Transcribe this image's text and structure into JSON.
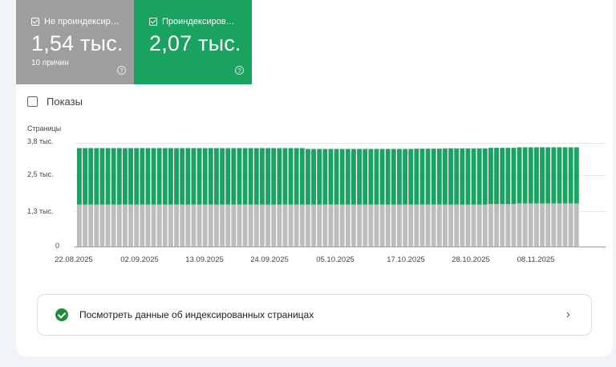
{
  "tiles": {
    "not_indexed": {
      "label": "Не проиндексир…",
      "value": "1,54 тыс.",
      "sub": "10 причин",
      "help": "?"
    },
    "indexed": {
      "label": "Проиндексиров…",
      "value": "2,07 тыс.",
      "help": "?"
    }
  },
  "impressions_label": "Показы",
  "link_label": "Посмотреть данные об индексированных страницах",
  "chart_data": {
    "type": "bar",
    "stacked": true,
    "ylabel": "Страницы",
    "ylim": [
      0,
      3800
    ],
    "yticks": [
      "3,8 тыс.",
      "2,5 тыс.",
      "1,3 тыс.",
      "0"
    ],
    "xticks": [
      "22.08.2025",
      "02.09.2025",
      "13.09.2025",
      "24.09.2025",
      "05.10.2025",
      "17.10.2025",
      "28.10.2025",
      "08.11.2025"
    ],
    "first_date": "22.08.2025",
    "last_date": "16.11.2025",
    "series": [
      {
        "name": "Не проиндексир…",
        "color": "#bdbdbd",
        "values": [
          1540,
          1540,
          1540,
          1540,
          1540,
          1540,
          1540,
          1540,
          1540,
          1540,
          1540,
          1540,
          1540,
          1540,
          1540,
          1540,
          1540,
          1540,
          1540,
          1540,
          1540,
          1540,
          1540,
          1540,
          1540,
          1540,
          1540,
          1540,
          1540,
          1540,
          1540,
          1540,
          1540,
          1540,
          1540,
          1540,
          1540,
          1540,
          1540,
          1540,
          1540,
          1540,
          1540,
          1540,
          1540,
          1540,
          1540,
          1540,
          1540,
          1540,
          1540,
          1540,
          1540,
          1540,
          1540,
          1540,
          1540,
          1540,
          1540,
          1540,
          1540,
          1540,
          1540,
          1540,
          1540,
          1540,
          1540,
          1540,
          1540,
          1540,
          1540,
          1540,
          1560,
          1560,
          1560,
          1560,
          1560,
          1580,
          1580,
          1580,
          1580,
          1580,
          1580,
          1580,
          1580,
          1580,
          1580,
          1580
        ]
      },
      {
        "name": "Проиндексиров…",
        "color": "#1aa260",
        "values": [
          2070,
          2070,
          2070,
          2070,
          2070,
          2070,
          2070,
          2070,
          2070,
          2070,
          2070,
          2070,
          2070,
          2070,
          2070,
          2070,
          2070,
          2070,
          2070,
          2070,
          2070,
          2070,
          2070,
          2070,
          2070,
          2070,
          2070,
          2070,
          2070,
          2070,
          2070,
          2070,
          2070,
          2070,
          2070,
          2070,
          2070,
          2070,
          2070,
          2070,
          2040,
          2040,
          2040,
          2040,
          2040,
          2040,
          2040,
          2040,
          2040,
          2040,
          2040,
          2040,
          2040,
          2040,
          2040,
          2040,
          2040,
          2040,
          2040,
          2050,
          2050,
          2050,
          2050,
          2050,
          2060,
          2060,
          2060,
          2060,
          2060,
          2060,
          2060,
          2060,
          2060,
          2060,
          2060,
          2060,
          2060,
          2060,
          2060,
          2060,
          2060,
          2060,
          2060,
          2060,
          2060,
          2060,
          2060,
          2060
        ]
      }
    ]
  }
}
